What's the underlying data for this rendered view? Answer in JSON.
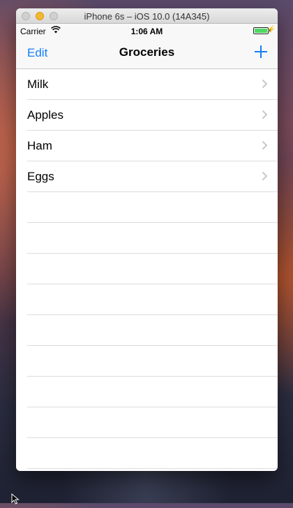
{
  "window": {
    "title": "iPhone 6s – iOS 10.0 (14A345)"
  },
  "statusbar": {
    "carrier": "Carrier",
    "time": "1:06 AM",
    "battery_level": 1.0
  },
  "navbar": {
    "edit_label": "Edit",
    "title": "Groceries",
    "add_icon": "plus-icon"
  },
  "items": [
    {
      "label": "Milk"
    },
    {
      "label": "Apples"
    },
    {
      "label": "Ham"
    },
    {
      "label": "Eggs"
    }
  ],
  "colors": {
    "accent": "#147efb",
    "battery": "#4cd964"
  }
}
